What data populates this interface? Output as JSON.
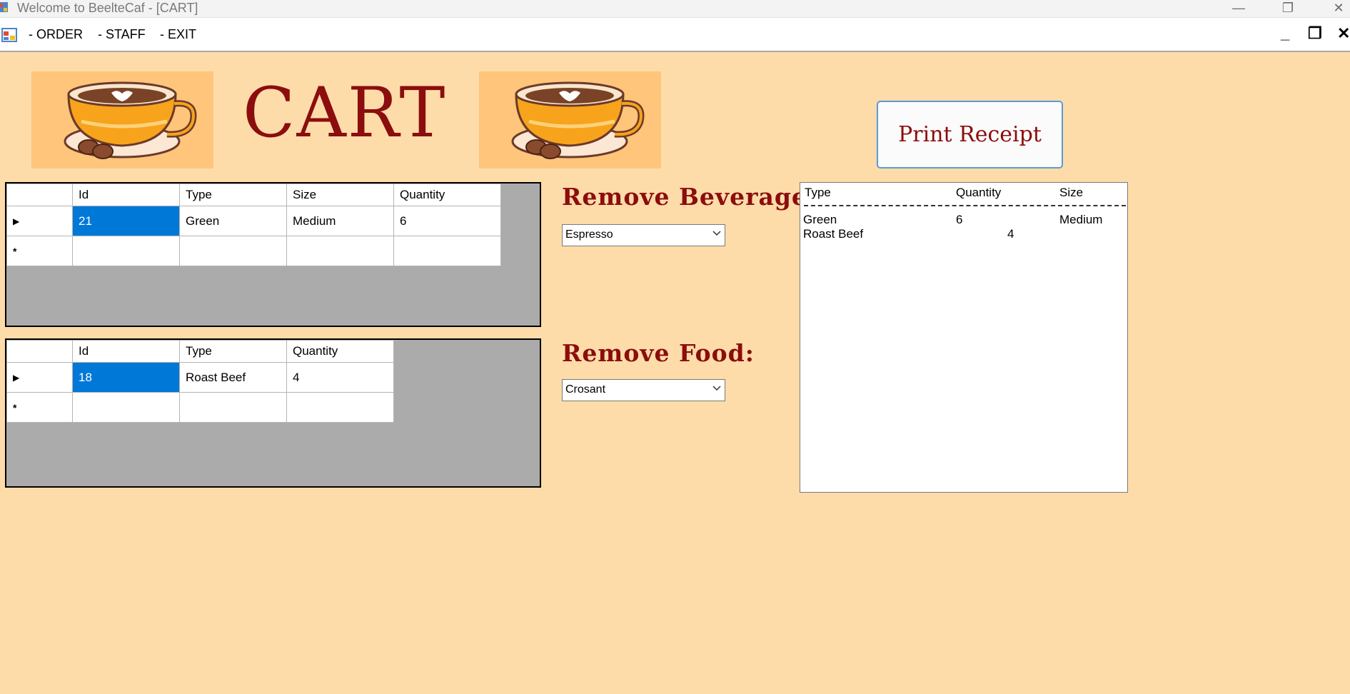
{
  "window": {
    "title": "Welcome to BeelteCaf - [CART]",
    "minimize_glyph": "—",
    "maximize_glyph": "❐",
    "close_glyph": "✕"
  },
  "menu": {
    "items": [
      "- ORDER",
      "- STAFF",
      "- EXIT"
    ],
    "mdi_minimize": "_",
    "mdi_restore": "❐",
    "mdi_close": "✕"
  },
  "header": {
    "title": "CART",
    "print_button": "Print Receipt"
  },
  "beverage_grid": {
    "columns": [
      "Id",
      "Type",
      "Size",
      "Quantity"
    ],
    "rows": [
      [
        "21",
        "Green",
        "Medium",
        "6"
      ]
    ],
    "row_marker": "▶",
    "new_row_marker": "*"
  },
  "food_grid": {
    "columns": [
      "Id",
      "Type",
      "Quantity"
    ],
    "rows": [
      [
        "18",
        "Roast Beef",
        "4"
      ]
    ],
    "row_marker": "▶",
    "new_row_marker": "*"
  },
  "remove_beverage": {
    "label": "Remove Beverage:",
    "selected": "Espresso"
  },
  "remove_food": {
    "label": "Remove Food:",
    "selected": "Crosant"
  },
  "receipt": {
    "headers": [
      "Type",
      "Quantity",
      "Size"
    ],
    "lines": [
      {
        "type": "Green",
        "quantity": "6",
        "size": "Medium"
      },
      {
        "type": "Roast Beef",
        "quantity": "4",
        "size": ""
      }
    ]
  },
  "colors": {
    "background": "#fddcaa",
    "accent": "#8b0d0d",
    "selection": "#0078d7",
    "cup_panel": "#ffc57a"
  },
  "icons": [
    "coffee-cup-icon",
    "app-icon",
    "dropdown-arrow-icon"
  ]
}
